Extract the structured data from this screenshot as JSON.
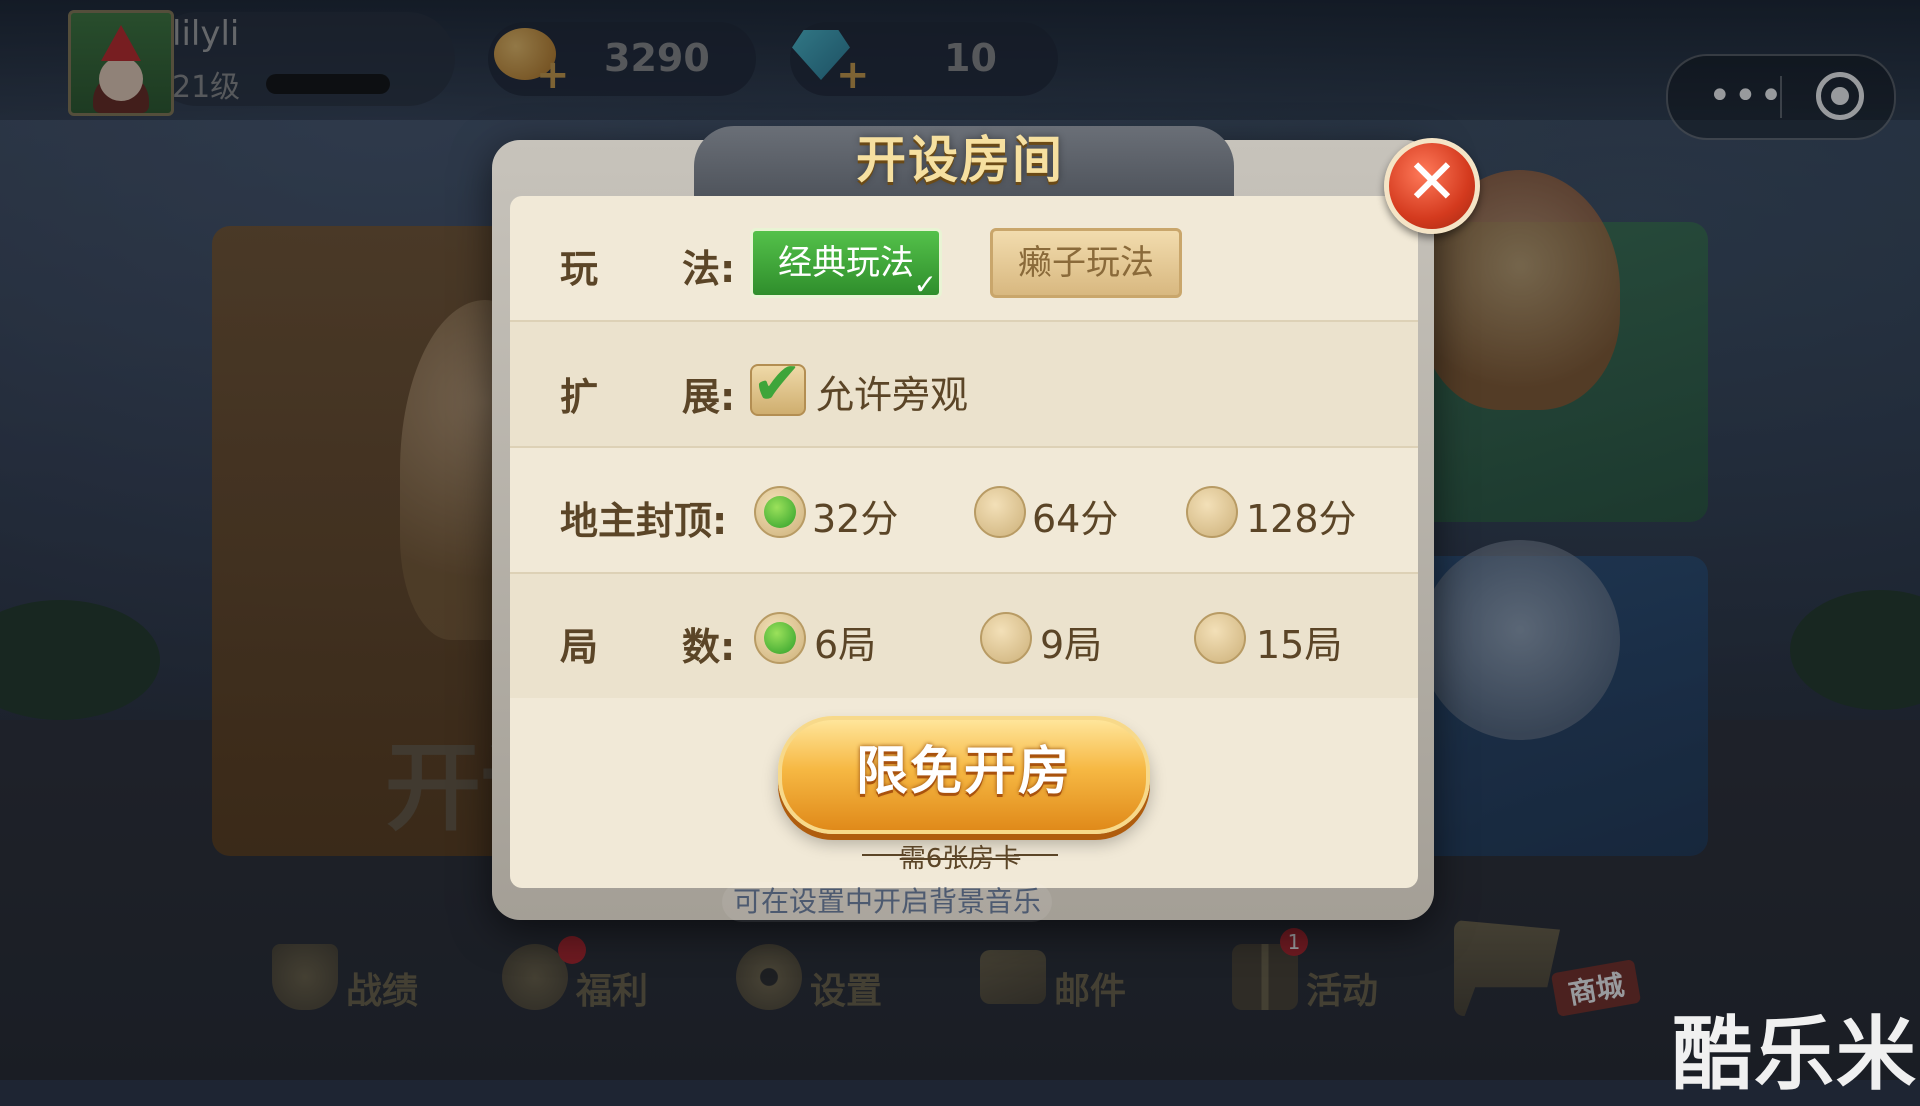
{
  "user": {
    "name": "lilyli",
    "level": "21级"
  },
  "resources": {
    "coins": "3290",
    "diamonds": "10"
  },
  "capsule": {
    "more_icon": "more-dots-icon",
    "close_icon": "target-icon"
  },
  "background": {
    "card_text": "开讠"
  },
  "dialog": {
    "title": "开设房间",
    "rows": {
      "mode": {
        "label_a": "玩",
        "label_b": "法:",
        "options": [
          "经典玩法",
          "癞子玩法"
        ],
        "selected": "经典玩法"
      },
      "extend": {
        "label_a": "扩",
        "label_b": "展:",
        "checkbox_label": "允许旁观",
        "checked": true
      },
      "cap": {
        "label": "地主封顶:",
        "options": [
          "32分",
          "64分",
          "128分"
        ],
        "selected": "32分"
      },
      "rounds": {
        "label_a": "局",
        "label_b": "数:",
        "options": [
          "6局",
          "9局",
          "15局"
        ],
        "selected": "6局"
      }
    },
    "open_button": "限免开房",
    "card_note": "需6张房卡"
  },
  "hint": "可在设置中开启背景音乐",
  "nav": [
    {
      "label": "战绩",
      "icon": "trophy-icon"
    },
    {
      "label": "福利",
      "icon": "money-bag-icon",
      "badge": ""
    },
    {
      "label": "设置",
      "icon": "gear-icon"
    },
    {
      "label": "邮件",
      "icon": "mail-icon"
    },
    {
      "label": "活动",
      "icon": "gift-icon",
      "badge": "1"
    },
    {
      "label": "商城",
      "icon": "cart-icon"
    }
  ],
  "watermark": "酷乐米"
}
